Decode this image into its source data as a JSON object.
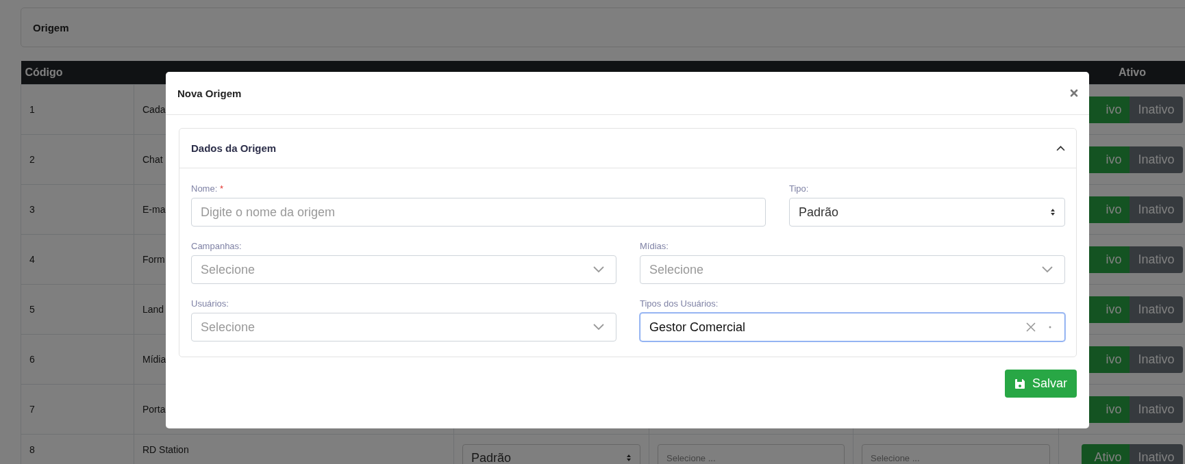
{
  "page": {
    "title": "Origem"
  },
  "table": {
    "columns": [
      "Código",
      "Ativo"
    ],
    "rows": [
      {
        "code": "1",
        "description": "Cada",
        "active_label": "ivo",
        "inactive_label": "Inativo"
      },
      {
        "code": "2",
        "description": "Chat",
        "active_label": "ivo",
        "inactive_label": "Inativo"
      },
      {
        "code": "3",
        "description": "E-ma",
        "active_label": "ivo",
        "inactive_label": "Inativo"
      },
      {
        "code": "4",
        "description": "Form",
        "active_label": "ivo",
        "inactive_label": "Inativo"
      },
      {
        "code": "5",
        "description": "Land",
        "active_label": "ivo",
        "inactive_label": "Inativo"
      },
      {
        "code": "6",
        "description": "Mídia",
        "active_label": "ivo",
        "inactive_label": "Inativo"
      },
      {
        "code": "7",
        "description": "Porta",
        "active_label": "ivo",
        "inactive_label": "Inativo"
      },
      {
        "code": "8",
        "description": "RD Station",
        "tipo": "Padrão",
        "campanhas": "Selecione ...",
        "midias": "Selecione ...",
        "active_label": "Ativo",
        "inactive_label": "Inativo"
      }
    ]
  },
  "modal": {
    "title": "Nova Origem",
    "section": {
      "title": "Dados da Origem",
      "expanded": true,
      "fields": [
        {
          "kind": "text",
          "label": "Nome:",
          "required_mark": "*",
          "placeholder": "Digite o nome da origem"
        },
        {
          "kind": "select",
          "label": "Tipo:",
          "value": "Padrão"
        },
        {
          "kind": "multiselect",
          "label": "Campanhas:",
          "placeholder": "Selecione"
        },
        {
          "kind": "multiselect",
          "label": "Mídias:",
          "placeholder": "Selecione"
        },
        {
          "kind": "multiselect",
          "label": "Usuários:",
          "placeholder": "Selecione"
        },
        {
          "kind": "multiselect",
          "label": "Tipos dos Usuários:",
          "value": "Gestor Comercial",
          "focused": true
        }
      ]
    },
    "save_button": "Salvar"
  }
}
